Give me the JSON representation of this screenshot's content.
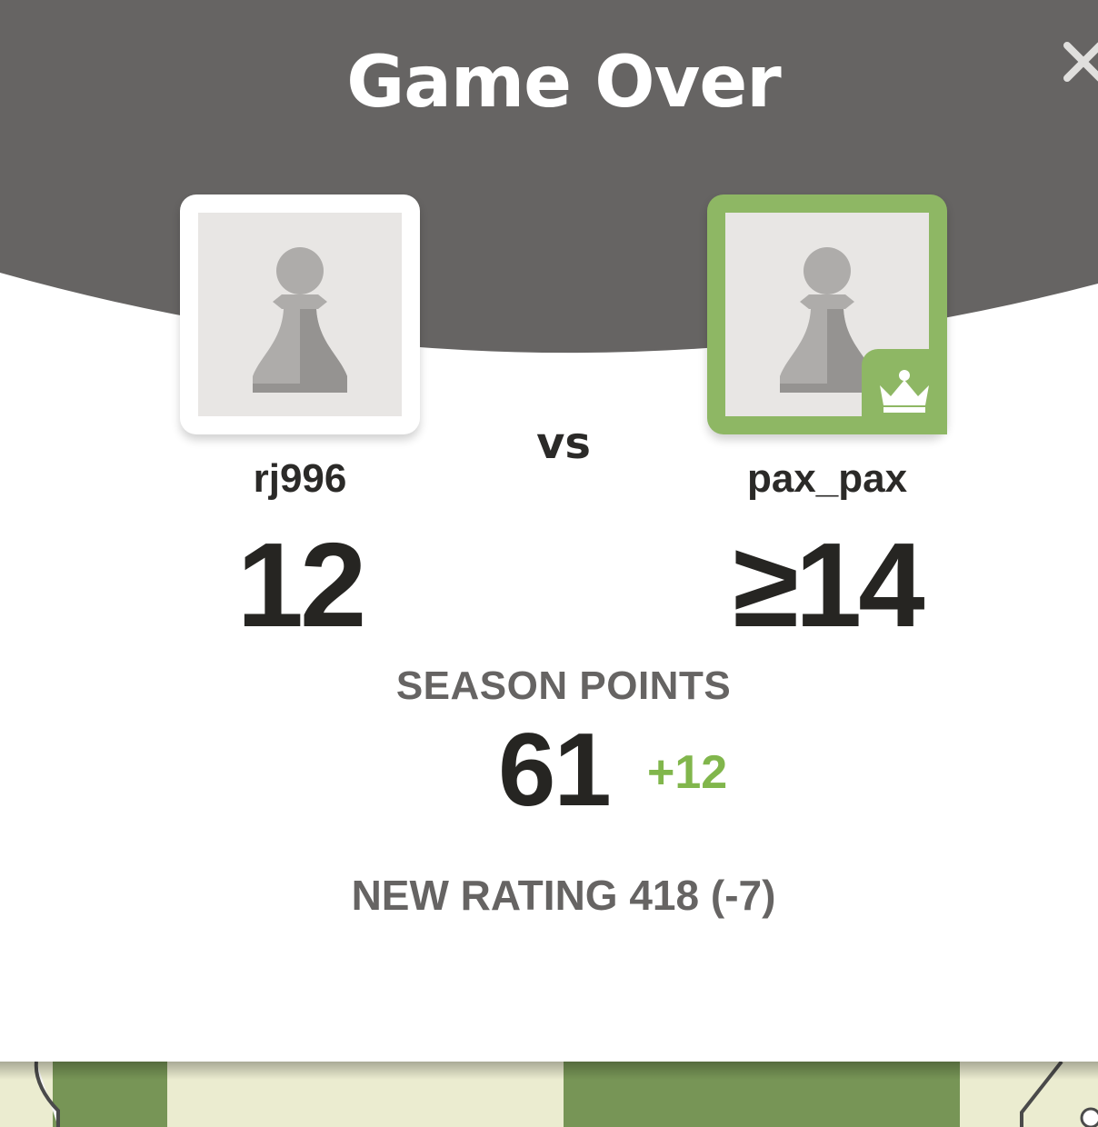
{
  "modal": {
    "title": "Game Over",
    "close_icon": "close-icon",
    "vs_label": "vs"
  },
  "players": {
    "left": {
      "name": "rj996",
      "score": "12",
      "avatar_icon": "pawn-icon",
      "is_winner": false
    },
    "right": {
      "name": "pax_pax",
      "score": "≥14",
      "avatar_icon": "pawn-icon",
      "badge_icon": "crown-icon",
      "is_winner": true
    }
  },
  "season": {
    "label": "SEASON POINTS",
    "points": "61",
    "delta": "+12"
  },
  "rating": {
    "text": "NEW RATING 418 (-7)"
  },
  "colors": {
    "header_gray": "#666463",
    "winner_green": "#8eb764",
    "delta_green": "#81b64c",
    "text_dark": "#262522",
    "text_muted": "#666463",
    "board_light": "#ebecd0",
    "board_dark": "#779556"
  }
}
